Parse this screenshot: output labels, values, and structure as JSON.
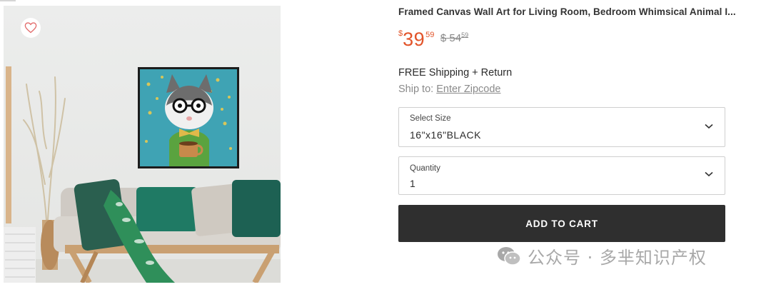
{
  "product": {
    "title": "Framed Canvas Wall Art for Living Room, Bedroom Whimsical Animal I...",
    "wishlist_icon": "heart-icon",
    "price": {
      "currency": "$",
      "integer": "39",
      "decimal": "59",
      "old_currency": "$",
      "old_integer": "54",
      "old_decimal": "59",
      "accent_color": "#e2542a"
    },
    "shipping_text": "FREE Shipping + Return",
    "ship_to_label": "Ship to:",
    "ship_to_link": "Enter Zipcode"
  },
  "options": {
    "size_label": "Select Size",
    "size_value": "16\"x16\"BLACK",
    "quantity_label": "Quantity",
    "quantity_value": "1",
    "dropdown_icon": "chevron-down-icon"
  },
  "cart": {
    "button_label": "ADD TO CART",
    "button_color": "#2f2f2f"
  },
  "watermark": {
    "text": "公众号 · 多芈知识产权",
    "icon": "wechat-icon"
  }
}
